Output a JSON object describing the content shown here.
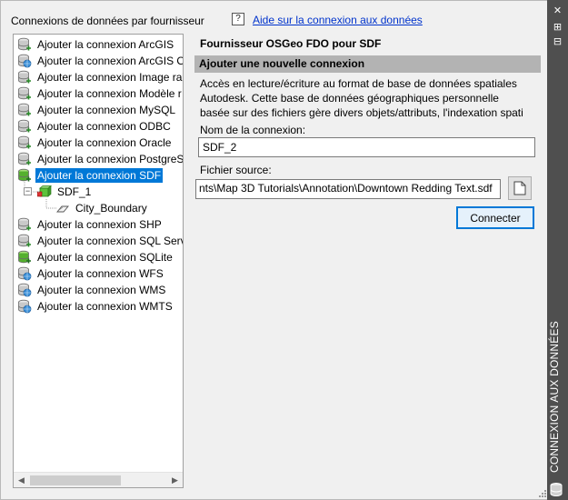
{
  "header": {
    "title": "Connexions de données par fournisseur",
    "help_icon_glyph": "?",
    "help_link": "Aide sur la connexion aux données"
  },
  "tree": {
    "items": [
      {
        "label": "Ajouter la connexion ArcGIS",
        "icon": "database-icon"
      },
      {
        "label": "Ajouter la connexion ArcGIS O",
        "icon": "globe-database-icon"
      },
      {
        "label": "Ajouter la connexion Image ra",
        "icon": "database-icon"
      },
      {
        "label": "Ajouter la connexion Modèle r",
        "icon": "database-icon"
      },
      {
        "label": "Ajouter la connexion MySQL",
        "icon": "database-icon"
      },
      {
        "label": "Ajouter la connexion ODBC",
        "icon": "database-icon"
      },
      {
        "label": "Ajouter la connexion Oracle",
        "icon": "database-icon"
      },
      {
        "label": "Ajouter la connexion PostgreS",
        "icon": "database-icon"
      },
      {
        "label": "Ajouter la connexion SDF",
        "icon": "green-database-icon",
        "selected": true
      },
      {
        "label": "SDF_1",
        "icon": "feature-source-icon",
        "level": 1
      },
      {
        "label": "City_Boundary",
        "icon": "polygon-layer-icon",
        "level": 2
      },
      {
        "label": "Ajouter la connexion SHP",
        "icon": "database-icon"
      },
      {
        "label": "Ajouter la connexion SQL Serv",
        "icon": "database-icon"
      },
      {
        "label": "Ajouter la connexion SQLite",
        "icon": "green-database-icon"
      },
      {
        "label": "Ajouter la connexion WFS",
        "icon": "globe-database-icon"
      },
      {
        "label": "Ajouter la connexion WMS",
        "icon": "globe-database-icon"
      },
      {
        "label": "Ajouter la connexion WMTS",
        "icon": "globe-database-icon"
      }
    ]
  },
  "details": {
    "provider_title": "Fournisseur OSGeo FDO pour SDF",
    "section_title": "Ajouter une nouvelle connexion",
    "description_lines": [
      "Accès en lecture/écriture au format de base de données spatiales",
      "Autodesk. Cette base de données géographiques personnelle",
      "basée sur des fichiers gère divers objets/attributs, l'indexation spati"
    ],
    "connection_name_label": "Nom de la connexion:",
    "connection_name_value": "SDF_2",
    "source_file_label": "Fichier source:",
    "source_file_value": "nts\\Map 3D Tutorials\\Annotation\\Downtown Redding Text.sdf",
    "connect_button": "Connecter"
  },
  "side_panel": {
    "title": "CONNEXION AUX DONNÉES",
    "close_glyph": "✕",
    "pin_glyph": "⊞",
    "settings_glyph": "⊟"
  },
  "colors": {
    "selection": "#0078d7",
    "section_bar": "#b3b3b3",
    "side_strip": "#4f4f4f",
    "link": "#0033cc"
  }
}
